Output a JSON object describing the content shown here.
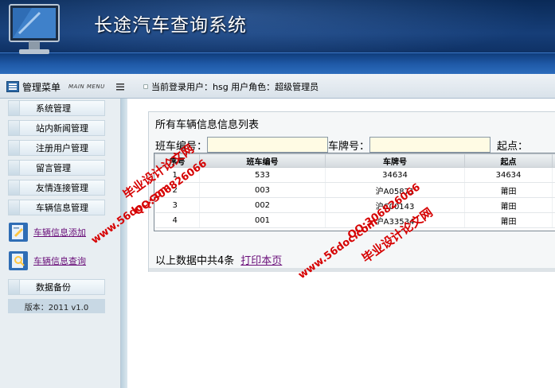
{
  "header": {
    "app_title": "长途汽车查询系统"
  },
  "topbar": {
    "menu_label": "管理菜单",
    "menu_sub": "MAIN MENU",
    "user_info": "当前登录用户：hsg  用户角色：超级管理员"
  },
  "sidebar": {
    "items": [
      {
        "label": "系统管理"
      },
      {
        "label": "站内新闻管理"
      },
      {
        "label": "注册用户管理"
      },
      {
        "label": "留言管理"
      },
      {
        "label": "友情连接管理"
      },
      {
        "label": "车辆信息管理"
      }
    ],
    "links": [
      {
        "label": "车辆信息添加"
      },
      {
        "label": "车辆信息查询"
      }
    ],
    "backup": "数据备份",
    "version": "版本：2011 v1.0"
  },
  "main": {
    "panel_title": "所有车辆信息信息列表",
    "search": {
      "label1": "班车编号：",
      "label2": "车牌号：",
      "label3": "起点：",
      "value1": "",
      "value2": ""
    },
    "table": {
      "headers": [
        "序号",
        "班车编号",
        "车牌号",
        "起点"
      ],
      "rows": [
        [
          "1",
          "533",
          "34634",
          "34634"
        ],
        [
          "2",
          "003",
          "沪A05871",
          "莆田"
        ],
        [
          "3",
          "002",
          "沪C00143",
          "莆田"
        ],
        [
          "4",
          "001",
          "沪A33534",
          "莆田"
        ]
      ]
    },
    "footer_text": "以上数据中共4条",
    "print_link": "打印本页"
  },
  "watermarks": {
    "site": "www.56doc.com",
    "qq": "QQ:306826066",
    "name": "毕业设计论文网"
  }
}
